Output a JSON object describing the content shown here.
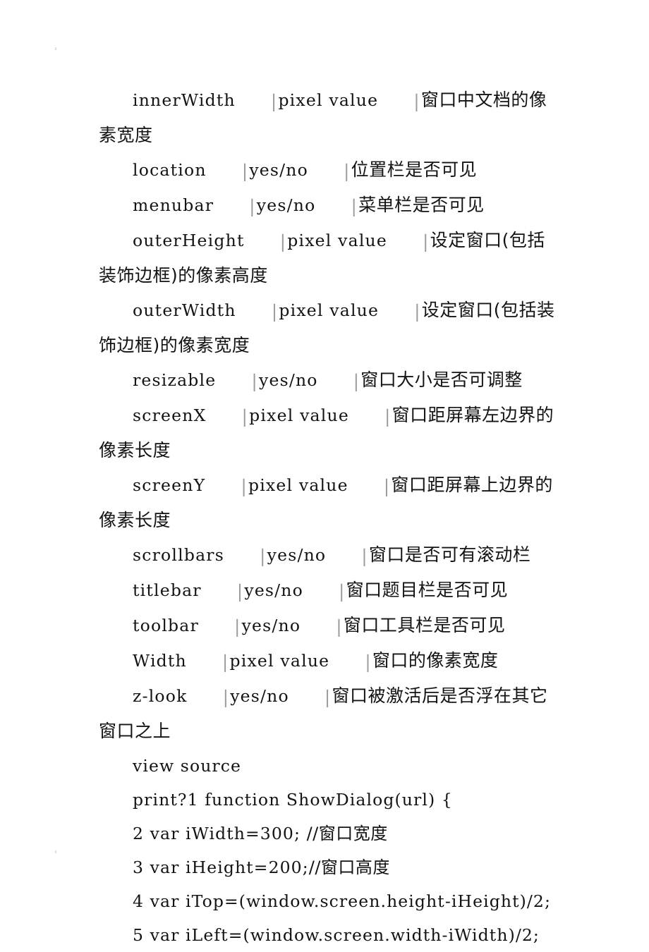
{
  "document": {
    "background_color": "#ffffff",
    "text_color": "#131313",
    "separator_color": "#9b9b9b",
    "separator_glyph": "|",
    "property_rows": [
      {
        "name": "innerWidth",
        "value": "pixel value",
        "description": "窗口中文档的像素宽度"
      },
      {
        "name": "location",
        "value": "yes/no",
        "description": "位置栏是否可见"
      },
      {
        "name": "menubar",
        "value": "yes/no",
        "description": "菜单栏是否可见"
      },
      {
        "name": "outerHeight",
        "value": "pixel value",
        "description": "设定窗口(包括装饰边框)的像素高度"
      },
      {
        "name": "outerWidth",
        "value": "pixel value",
        "description": "设定窗口(包括装饰边框)的像素宽度"
      },
      {
        "name": "resizable",
        "value": "yes/no",
        "description": "窗口大小是否可调整"
      },
      {
        "name": "screenX",
        "value": "pixel value",
        "description": "窗口距屏幕左边界的像素长度"
      },
      {
        "name": "screenY",
        "value": "pixel value",
        "description": "窗口距屏幕上边界的像素长度"
      },
      {
        "name": "scrollbars",
        "value": "yes/no",
        "description": "窗口是否可有滚动栏"
      },
      {
        "name": "titlebar",
        "value": "yes/no",
        "description": "窗口题目栏是否可见"
      },
      {
        "name": "toolbar",
        "value": "yes/no",
        "description": "窗口工具栏是否可见"
      },
      {
        "name": "Width",
        "value": "pixel value",
        "description": "窗口的像素宽度"
      },
      {
        "name": "z-look",
        "value": "yes/no",
        "description": "窗口被激活后是否浮在其它窗口之上"
      }
    ],
    "code_block": {
      "view_source_label": "view source",
      "lines": [
        {
          "prefix": "print?1",
          "code": " function ShowDialog(url) {",
          "comment": ""
        },
        {
          "prefix": "2",
          "code": " var iWidth=300; ",
          "comment": "//窗口宽度"
        },
        {
          "prefix": "3",
          "code": " var iHeight=200;",
          "comment": "//窗口高度"
        },
        {
          "prefix": "4",
          "code": " var iTop=(window.screen.height-iHeight)/2;",
          "comment": ""
        },
        {
          "prefix": "5",
          "code": " var iLeft=(window.screen.width-iWidth)/2;",
          "comment": ""
        }
      ]
    }
  }
}
